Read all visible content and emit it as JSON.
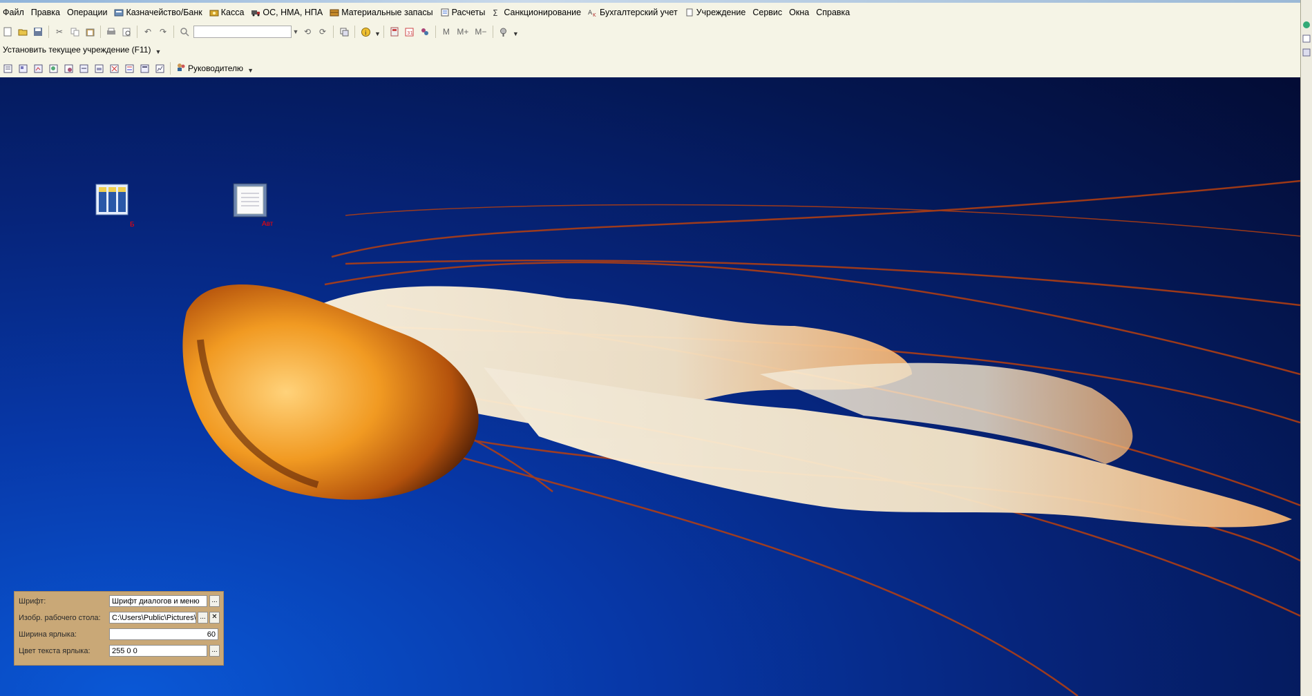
{
  "menubar": {
    "items": [
      {
        "label": "Файл",
        "icon": null
      },
      {
        "label": "Правка",
        "icon": null
      },
      {
        "label": "Операции",
        "icon": null
      },
      {
        "label": "Казначейство/Банк",
        "icon": "treasury-icon"
      },
      {
        "label": "Касса",
        "icon": "cash-icon"
      },
      {
        "label": "ОС, НМА, НПА",
        "icon": "truck-icon"
      },
      {
        "label": "Материальные запасы",
        "icon": "materials-icon"
      },
      {
        "label": "Расчеты",
        "icon": "calculations-icon"
      },
      {
        "label": "Санкционирование",
        "icon": "sanction-icon"
      },
      {
        "label": "Бухгалтерский учет",
        "icon": "accounting-icon"
      },
      {
        "label": "Учреждение",
        "icon": "institution-icon"
      },
      {
        "label": "Сервис",
        "icon": null
      },
      {
        "label": "Окна",
        "icon": null
      },
      {
        "label": "Справка",
        "icon": null
      }
    ]
  },
  "toolbar2": {
    "set_institution_label": "Установить текущее учреждение (F11)"
  },
  "toolbar3": {
    "manager_label": "Руководителю"
  },
  "desktop": {
    "shortcuts": [
      {
        "label": "Б",
        "icon": "journal-columns-icon"
      },
      {
        "label": "Авт",
        "icon": "document-icon"
      }
    ],
    "shortcut_label_color": "#ff0000"
  },
  "properties": {
    "rows": [
      {
        "label": "Шрифт:",
        "value": "Шрифт диалогов и меню",
        "button": "..."
      },
      {
        "label": "Изобр. рабочего стола:",
        "value": "C:\\Users\\Public\\Pictures\\Sample Pictures\\Jellyfish.jpg",
        "button": "..."
      },
      {
        "label": "Ширина ярлыка:",
        "value": "60",
        "button": ""
      },
      {
        "label": "Цвет текста ярлыка:",
        "value": "255 0 0",
        "button": "..."
      }
    ],
    "clear_button": "✕"
  },
  "colors": {
    "panel_bg": "#f5f4e6",
    "desktop_bg": "#06247a",
    "property_panel_bg": "#c9a877"
  }
}
